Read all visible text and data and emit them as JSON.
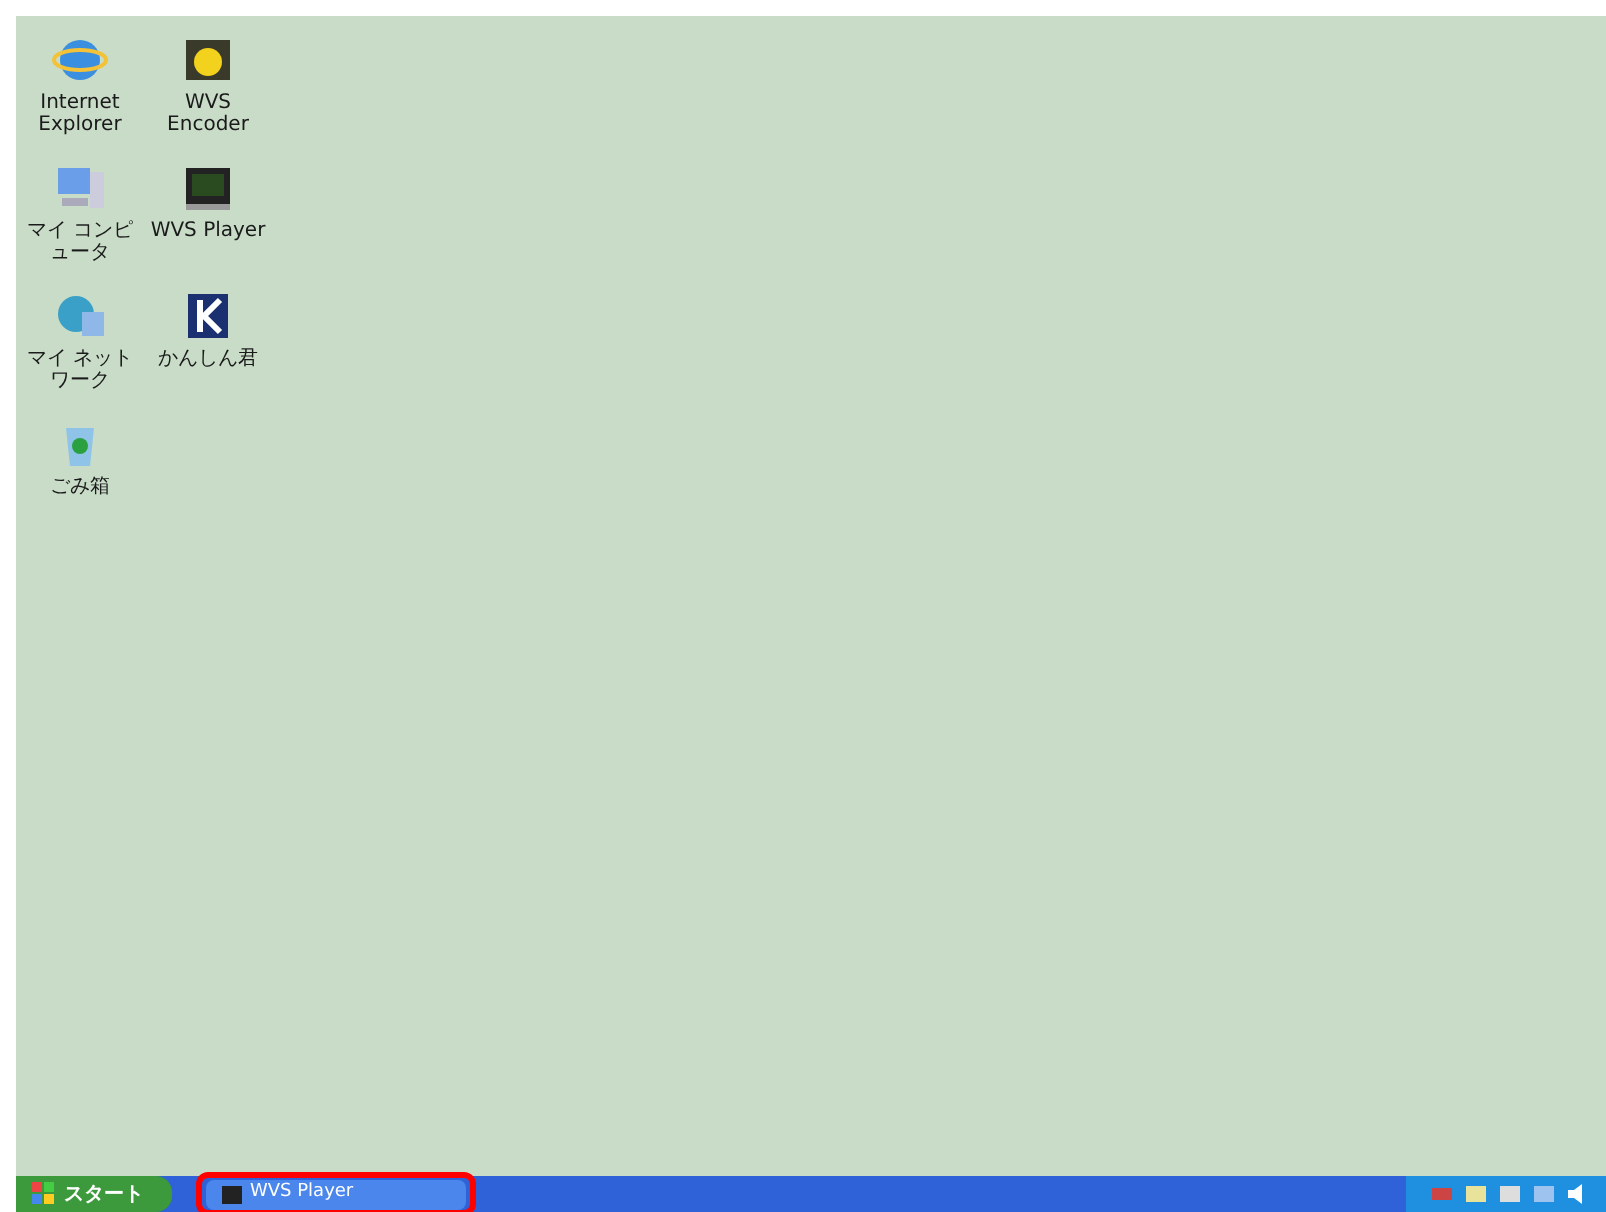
{
  "desktop_icons": [
    {
      "label": "Internet Explorer",
      "kind": "browser"
    },
    {
      "label": "WVS Encoder",
      "kind": "encoder"
    },
    {
      "label": "マイ コンピュータ",
      "kind": "computer"
    },
    {
      "label": "WVS Player",
      "kind": "player"
    },
    {
      "label": "マイ ネットワーク",
      "kind": "network"
    },
    {
      "label": "かんしん君",
      "kind": "app"
    },
    {
      "label": "ごみ箱",
      "kind": "trash"
    }
  ],
  "taskbar": {
    "start_button": "スタート",
    "tasks": [
      {
        "label": "WVS Player",
        "highlighted": true
      }
    ]
  }
}
